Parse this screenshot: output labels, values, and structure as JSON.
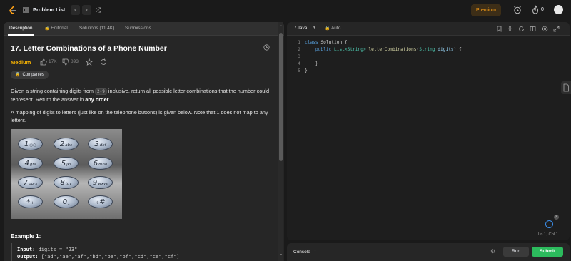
{
  "topbar": {
    "problem_list_label": "Problem List",
    "prev_symbol": "‹",
    "next_symbol": "›",
    "shuffle_symbol": "⤮",
    "premium_label": "Premium",
    "streak_count": "0"
  },
  "tabs": [
    {
      "label": "Description"
    },
    {
      "label": "Editorial"
    },
    {
      "label": "Solutions (11.4K)"
    },
    {
      "label": "Submissions"
    }
  ],
  "problem": {
    "title": "17. Letter Combinations of a Phone Number",
    "difficulty": "Medium",
    "likes": "17K",
    "dislikes": "893",
    "companies_label": "Companies",
    "desc_p1_a": "Given a string containing digits from ",
    "desc_p1_code": "2-9",
    "desc_p1_b": " inclusive, return all possible letter combinations that the number could represent. Return the answer in ",
    "desc_p1_bold": "any order",
    "desc_p1_end": ".",
    "desc_p2": "A mapping of digits to letters (just like on the telephone buttons) is given below. Note that 1 does not map to any letters.",
    "keypad": [
      {
        "num": "1",
        "let": "○○"
      },
      {
        "num": "2",
        "let": "abc"
      },
      {
        "num": "3",
        "let": "def"
      },
      {
        "num": "4",
        "let": "ghi"
      },
      {
        "num": "5",
        "let": "jkl"
      },
      {
        "num": "6",
        "let": "mno"
      },
      {
        "num": "7",
        "let": "pqrs"
      },
      {
        "num": "8",
        "let": "tuv"
      },
      {
        "num": "9",
        "let": "wxyz"
      },
      {
        "num": "*",
        "let": "+"
      },
      {
        "num": "0",
        "let": "⎵"
      },
      {
        "num": "#",
        "let": "⇧"
      }
    ],
    "example_title": "Example 1:",
    "example_input_label": "Input:",
    "example_input": " digits = \"23\"",
    "example_output_label": "Output:",
    "example_output": " [\"ad\",\"ae\",\"af\",\"bd\",\"be\",\"bf\",\"cd\",\"ce\",\"cf\"]"
  },
  "editor": {
    "language": "Java",
    "autosave_label": "Auto",
    "code_lines": [
      {
        "n": "1"
      },
      {
        "n": "2"
      },
      {
        "n": "3"
      },
      {
        "n": "4"
      },
      {
        "n": "5"
      }
    ],
    "code": {
      "l1_kw": "class",
      "l1_rest": " Solution {",
      "l2_kw": "    public",
      "l2_ty": " List<String>",
      "l2_fn": " letterCombinations",
      "l2_open": "(",
      "l2_pty": "String",
      "l2_pm": " digits",
      "l2_close": ") {",
      "l3": "",
      "l4": "    }",
      "l5": "}"
    },
    "cursor_status": "Ln 1, Col 1"
  },
  "console": {
    "label": "Console",
    "run_label": "Run",
    "submit_label": "Submit"
  },
  "colors": {
    "accent_orange": "#ffa116",
    "medium": "#ffb800",
    "submit_green": "#2cbb5d"
  }
}
